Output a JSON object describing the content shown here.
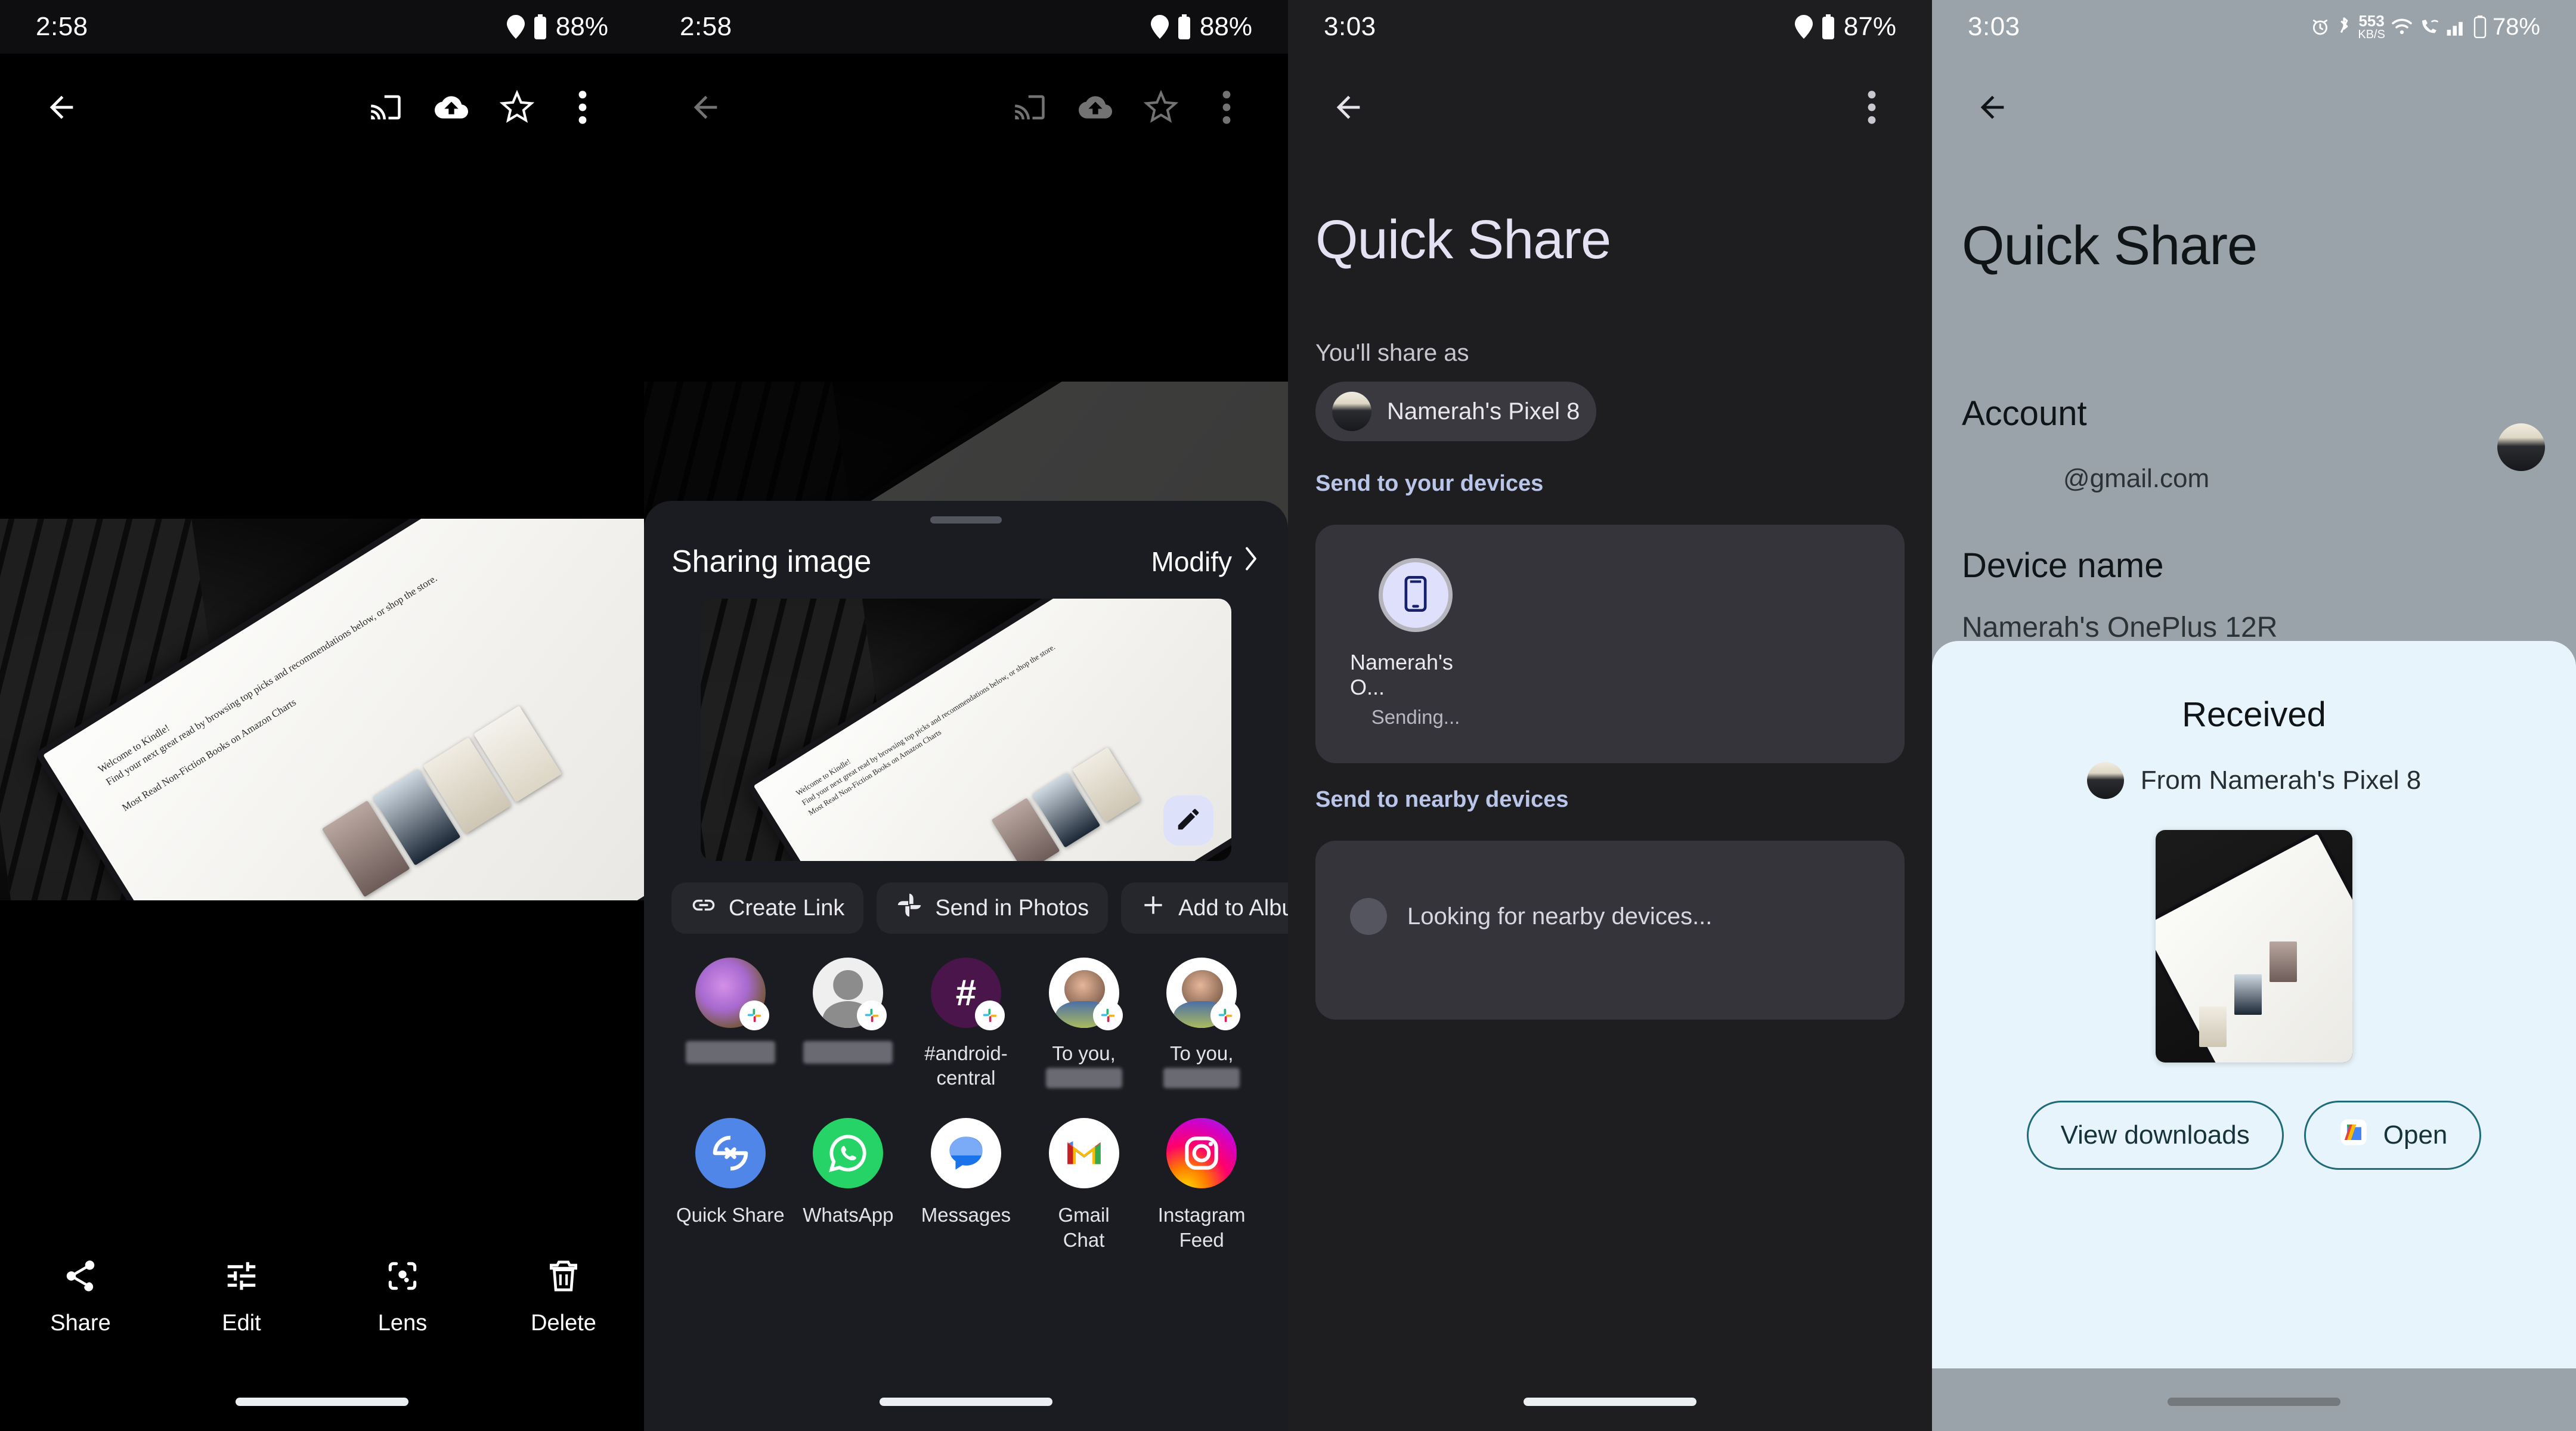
{
  "panel1": {
    "name": "photo-viewer",
    "status": {
      "time": "2:58",
      "battery": "88%",
      "icons": [
        "location-icon",
        "battery-icon"
      ]
    },
    "toolbar": {
      "back": "back-arrow-icon",
      "actions": [
        "cast-icon",
        "cloud-upload-icon",
        "star-icon",
        "more-vert-icon"
      ]
    },
    "bottom_actions": [
      {
        "icon": "share-icon",
        "label": "Share"
      },
      {
        "icon": "tune-icon",
        "label": "Edit"
      },
      {
        "icon": "lens-icon",
        "label": "Lens"
      },
      {
        "icon": "delete-icon",
        "label": "Delete"
      }
    ],
    "photo_caption": "Photo of a Kindle Scribe tablet on a black keyboard case showing the Welcome to Kindle home screen"
  },
  "panel2": {
    "name": "android-share-sheet",
    "status": {
      "time": "2:58",
      "battery": "88%"
    },
    "toolbar": {
      "back": "back-arrow-icon",
      "actions": [
        "cast-icon",
        "cloud-upload-icon",
        "star-icon",
        "more-vert-icon"
      ]
    },
    "sheet": {
      "title": "Sharing image",
      "modify_label": "Modify",
      "modify_icon": "chevron-right-icon",
      "edit_fab": "pencil-icon",
      "chips": [
        {
          "icon": "link-icon",
          "label": "Create Link"
        },
        {
          "icon": "photos-icon",
          "label": "Send in Photos"
        },
        {
          "icon": "plus-icon",
          "label": "Add to Album"
        },
        {
          "icon": "save-image-icon",
          "label": ""
        }
      ],
      "contacts": [
        {
          "avatar": "purple-portrait",
          "badge": "slack-icon",
          "name": "",
          "redacted": true
        },
        {
          "avatar": "generic-person",
          "badge": "slack-icon",
          "name": "",
          "redacted": true
        },
        {
          "avatar": "hash-channel",
          "badge": "slack-icon",
          "name": "#android-central",
          "redacted": false
        },
        {
          "avatar": "person-photo",
          "badge": "slack-icon",
          "name": "To you,",
          "sub": "",
          "redacted": true
        },
        {
          "avatar": "person-photo",
          "badge": "slack-icon",
          "name": "To you,",
          "sub": "",
          "redacted": true
        }
      ],
      "apps": [
        {
          "icon": "quick-share-icon",
          "label": "Quick Share"
        },
        {
          "icon": "whatsapp-icon",
          "label": "WhatsApp"
        },
        {
          "icon": "messages-icon",
          "label": "Messages"
        },
        {
          "icon": "gmail-icon",
          "label": "Gmail\nChat"
        },
        {
          "icon": "instagram-icon",
          "label": "Instagram\nFeed"
        }
      ]
    }
  },
  "panel3": {
    "name": "quick-share-sender",
    "status": {
      "time": "3:03",
      "battery": "87%"
    },
    "toolbar": {
      "back": "back-arrow-icon",
      "more": "more-vert-icon"
    },
    "title": "Quick Share",
    "share_as_label": "You'll share as",
    "share_as_device": "Namerah's Pixel 8",
    "your_devices_label": "Send to your devices",
    "device": {
      "icon": "phone-icon",
      "name": "Namerah's O...",
      "state": "Sending..."
    },
    "nearby_label": "Send to nearby devices",
    "nearby_state": "Looking for nearby devices..."
  },
  "panel4": {
    "name": "quick-share-receiver",
    "status": {
      "time": "3:03",
      "battery": "78%",
      "data_rate": "553",
      "data_unit": "KB/S",
      "icons": [
        "alarm-icon",
        "bluetooth-icon",
        "data-rate",
        "wifi-icon",
        "wifi-calling-icon",
        "signal-icon",
        "battery-icon"
      ]
    },
    "toolbar": {
      "back": "back-arrow-icon"
    },
    "title": "Quick Share",
    "rows": [
      {
        "label": "Account",
        "value": "@gmail.com"
      },
      {
        "label": "Device name",
        "value": "Namerah's OnePlus 12R"
      }
    ],
    "received": {
      "title": "Received",
      "from_label": "From Namerah's Pixel 8",
      "buttons": [
        {
          "label": "View downloads",
          "icon": ""
        },
        {
          "label": "Open",
          "icon": "files-icon"
        }
      ]
    }
  },
  "colors": {
    "sheet_bg": "#1b1c21",
    "chip_bg": "#26272d",
    "quick_share_accent": "#b9c6ea",
    "received_bg": "#e8f4fb",
    "received_outline": "#1f6b7a",
    "panel4_bg": "#9aa3a9",
    "fab_bg": "#dde1f9"
  }
}
